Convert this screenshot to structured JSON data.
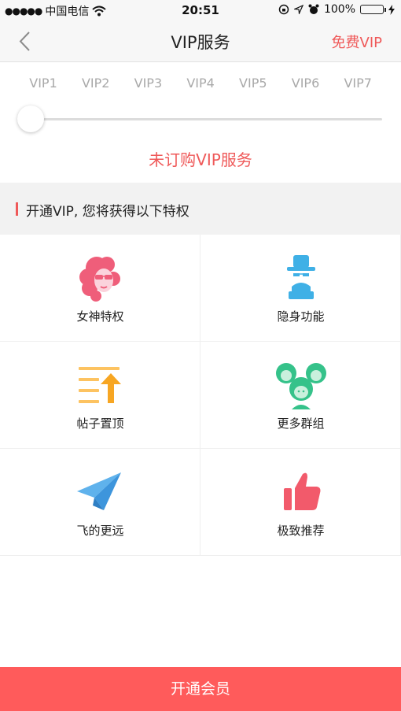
{
  "colors": {
    "accent": "#ef5959",
    "button_bg": "#ff5b5b",
    "divider": "#efefef"
  },
  "status_bar": {
    "signal": "●●●●●",
    "carrier": "中国电信",
    "time": "20:51",
    "battery": "100%"
  },
  "nav": {
    "back_icon": "chevron-left-icon",
    "title": "VIP服务",
    "action": "免费VIP"
  },
  "levels": [
    "VIP1",
    "VIP2",
    "VIP3",
    "VIP4",
    "VIP5",
    "VIP6",
    "VIP7"
  ],
  "slider": {
    "value_fraction": 0
  },
  "subscribe_status": "未订购VIP服务",
  "section_title": "开通VIP, 您将获得以下特权",
  "privileges": [
    {
      "label": "女神特权",
      "icon": "goddess-icon"
    },
    {
      "label": "隐身功能",
      "icon": "invisible-icon"
    },
    {
      "label": "帖子置顶",
      "icon": "pin-to-top-icon"
    },
    {
      "label": "更多群组",
      "icon": "group-icon"
    },
    {
      "label": "飞的更远",
      "icon": "paper-plane-icon"
    },
    {
      "label": "极致推荐",
      "icon": "thumbs-up-icon"
    }
  ],
  "bottom_button": "开通会员"
}
